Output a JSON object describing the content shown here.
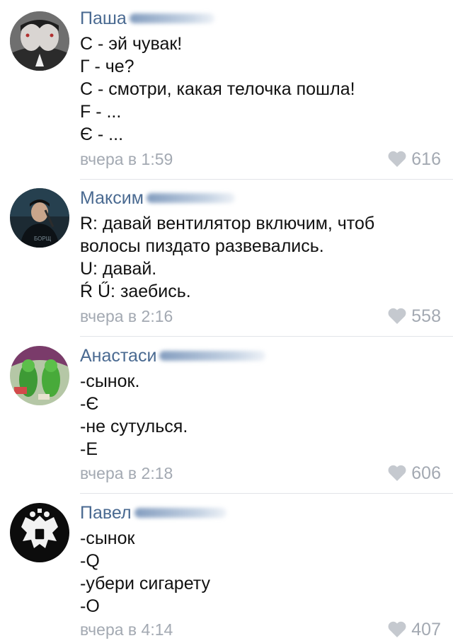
{
  "colors": {
    "author": "#4a6a91",
    "text": "#111111",
    "meta": "#a3a9b2",
    "divider": "#e2e4e8"
  },
  "comments": [
    {
      "author": "Паша",
      "lines": [
        "С - эй чувак!",
        "Г - че?",
        "С - смотри, какая телочка пошла!",
        "F - ...",
        "Є - ..."
      ],
      "time": "вчера в 1:59",
      "likes": "616",
      "avatar_icon": "mirrored-face-avatar"
    },
    {
      "author": "Максим",
      "lines": [
        "R: давай вентилятор включим, чтоб",
        "волосы пиздато развевались.",
        "U: давай.",
        "Ŕ Ű: заебись."
      ],
      "time": "вчера в 2:16",
      "likes": "558",
      "avatar_icon": "singer-photo-avatar"
    },
    {
      "author": "Анастаси",
      "lines": [
        "-сынок.",
        "-Є",
        "-не сутулься.",
        "-Е"
      ],
      "time": "вчера в 2:18",
      "likes": "606",
      "avatar_icon": "green-figures-avatar"
    },
    {
      "author": "Павел",
      "lines": [
        "-сынок",
        "-Q",
        "-убери сигарету",
        "-О"
      ],
      "time": "вчера в 4:14",
      "likes": "407",
      "avatar_icon": "double-eagle-emblem-avatar"
    }
  ]
}
